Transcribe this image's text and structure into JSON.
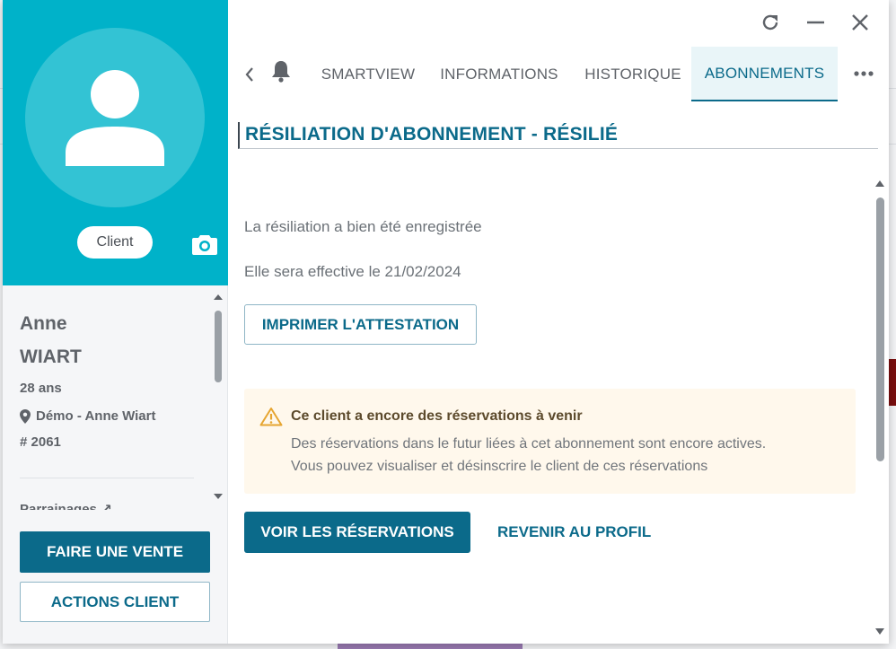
{
  "profile": {
    "role_badge": "Client",
    "first_name": "Anne",
    "last_name": "WIART",
    "age": "28 ans",
    "location": "Démo - Anne Wiart",
    "member_id": "# 2061",
    "parrainages": "Parrainages"
  },
  "actions": {
    "sale_label": "FAIRE UNE VENTE",
    "client_actions_label": "ACTIONS CLIENT"
  },
  "tabs": [
    {
      "label": "SMARTVIEW"
    },
    {
      "label": "INFORMATIONS"
    },
    {
      "label": "HISTORIQUE"
    },
    {
      "label": "ABONNEMENTS",
      "active": true
    }
  ],
  "section": {
    "title": "RÉSILIATION D'ABONNEMENT - RÉSILIÉ"
  },
  "result": {
    "message_recorded": "La résiliation a bien été enregistrée",
    "message_effective": "Elle sera effective le 21/02/2024",
    "print_label": "IMPRIMER L'ATTESTATION"
  },
  "alert": {
    "title": "Ce client a encore des réservations à venir",
    "line1": "Des réservations dans le futur liées à cet abonnement sont encore actives.",
    "line2": "Vous pouvez visualiser et désinscrire le client de ces réservations"
  },
  "footer": {
    "view_reservations_label": "VOIR LES RÉSERVATIONS",
    "back_to_profile_label": "REVENIR AU PROFIL"
  },
  "colors": {
    "brand_teal": "#00b2c9",
    "primary": "#0b6a8a",
    "alert_bg": "#fff8ec",
    "warning": "#e6a530"
  }
}
